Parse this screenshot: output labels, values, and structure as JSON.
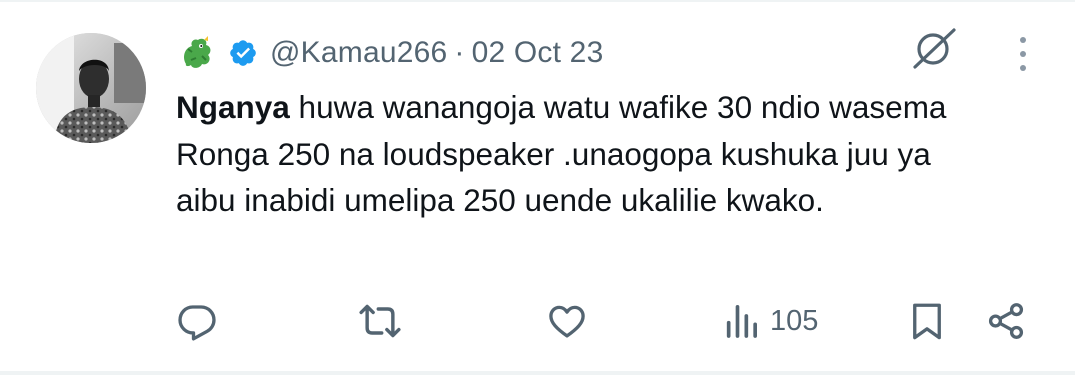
{
  "tweet": {
    "emoji_badge": "dragon-emoji",
    "verified_icon": "verified-badge-icon",
    "handle": "@Kamau266",
    "separator": "·",
    "date": "02 Oct 23",
    "mention": "Nganya",
    "text": " huwa wanangoja watu wafike 30 ndio wasema Ronga 250 na loudspeaker .unaogopa kushuka juu ya aibu inabidi umelipa 250 uende ukalilie kwako."
  },
  "actions": {
    "reply_icon": "reply-icon",
    "retweet_icon": "retweet-icon",
    "like_icon": "heart-icon",
    "views_icon": "views-bar-chart-icon",
    "views_count": "105",
    "bookmark_icon": "bookmark-icon",
    "share_icon": "share-icon"
  },
  "colors": {
    "text_primary": "#0f1419",
    "text_secondary": "#536471",
    "verified_blue": "#1d9bf0",
    "divider": "#eff3f4"
  }
}
